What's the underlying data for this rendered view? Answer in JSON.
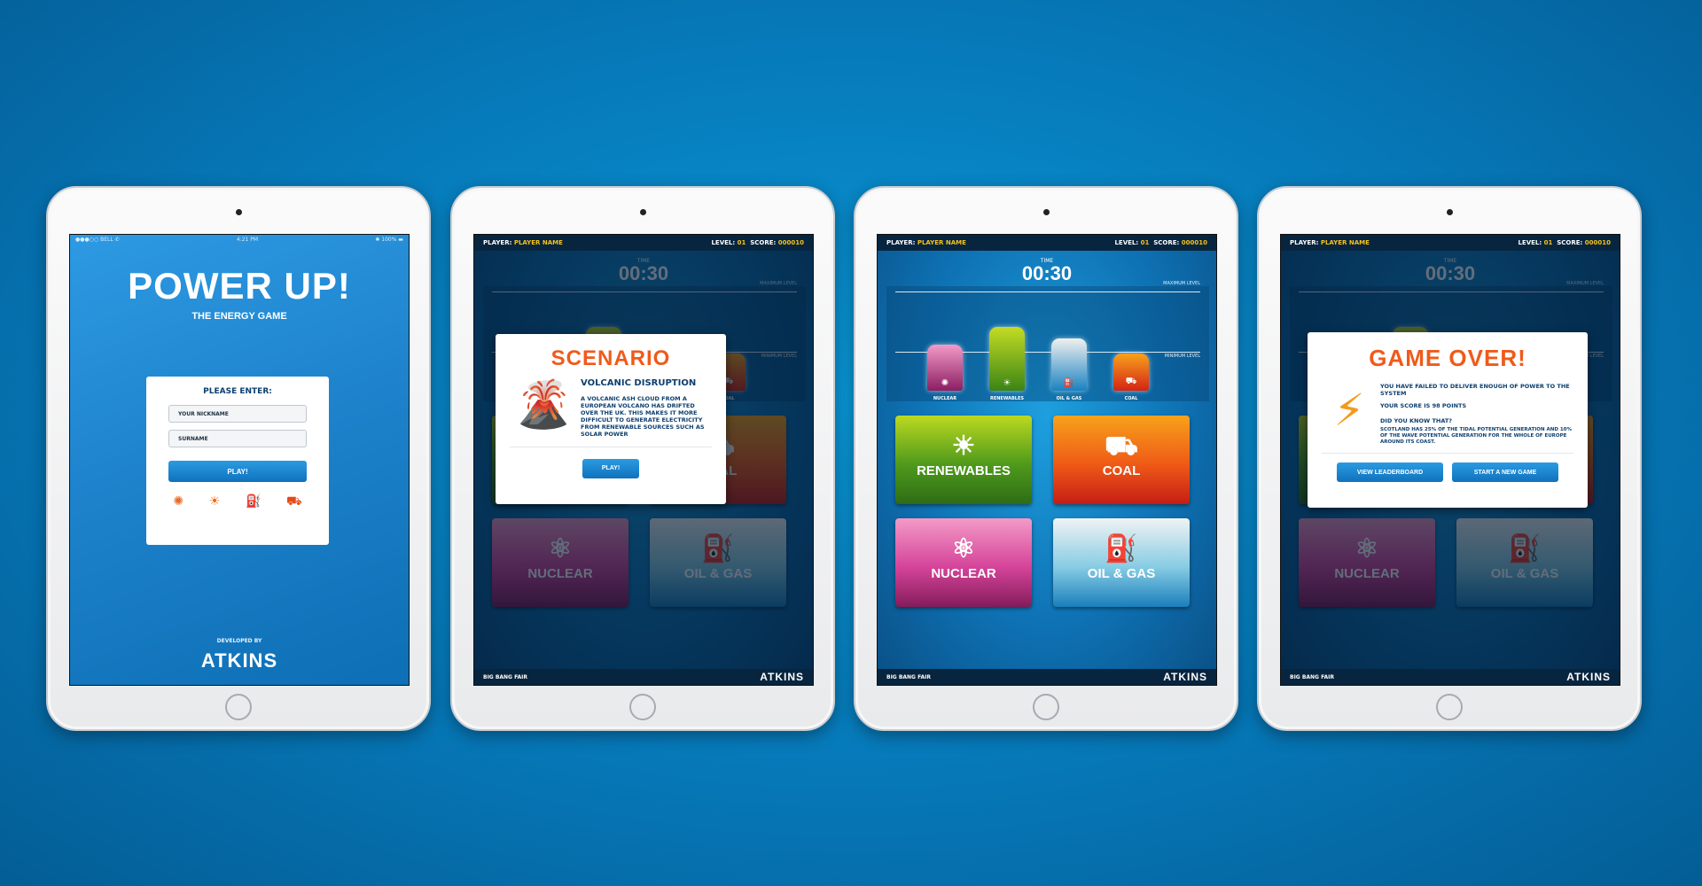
{
  "colors": {
    "background": "#0678b8",
    "accent_orange": "#f05a1a",
    "brand_blue": "#0f72bd",
    "hud_yellow": "#f6c21a"
  },
  "login": {
    "status": {
      "carrier": "●●●○○ BELL ✆",
      "time": "4:21 PM",
      "battery": "✱ 100% ▬"
    },
    "title": "POWER UP!",
    "subtitle": "THE ENERGY GAME",
    "prompt": "PLEASE ENTER:",
    "nickname_placeholder": "YOUR NICKNAME",
    "surname_placeholder": "SURNAME",
    "play_label": "PLAY!",
    "icons": [
      "nuclear-icon",
      "renewables-icon",
      "oil-gas-icon",
      "coal-icon"
    ],
    "developed_by": "DEVELOPED BY",
    "logo": "ATKINS"
  },
  "hud": {
    "player_label": "PLAYER:",
    "player_name": "PLAYER NAME",
    "level_label": "LEVEL:",
    "level": "01",
    "score_label": "SCORE:",
    "score": "000010",
    "time_label": "TIME",
    "time": "00:30",
    "max_label": "MAXIMUM LEVEL",
    "min_label": "MINIMUM LEVEL"
  },
  "energy": {
    "bars": [
      {
        "label": "NUCLEAR",
        "level": 0.52,
        "color_top": "#f29ac8",
        "color_bottom": "#8b1e62"
      },
      {
        "label": "RENEWABLES",
        "level": 0.72,
        "color_top": "#c4dc23",
        "color_bottom": "#3b8416"
      },
      {
        "label": "OIL & GAS",
        "level": 0.59,
        "color_top": "#f0f0ee",
        "color_bottom": "#1a82c2"
      },
      {
        "label": "COAL",
        "level": 0.42,
        "color_top": "#f8a11c",
        "color_bottom": "#d42414"
      }
    ],
    "tiles": {
      "renewables": "RENEWABLES",
      "coal": "COAL",
      "nuclear": "NUCLEAR",
      "oil_gas": "OIL & GAS"
    }
  },
  "footer": {
    "event": "BIG BANG FAIR",
    "logo": "ATKINS"
  },
  "scenario": {
    "title": "SCENARIO",
    "heading": "VOLCANIC DISRUPTION",
    "body": "A VOLCANIC ASH CLOUD FROM A EUROPEAN VOLCANO HAS DRIFTED OVER THE UK. THIS MAKES IT MORE DIFFICULT TO GENERATE ELECTRICITY FROM RENEWABLE SOURCES SUCH AS SOLAR POWER",
    "play_label": "PLAY!"
  },
  "gameover": {
    "title": "GAME OVER!",
    "message": "YOU HAVE FAILED TO DELIVER ENOUGH OF POWER TO THE SYSTEM",
    "score_text": "YOUR SCORE IS 98 POINTS",
    "fact_heading": "DID YOU KNOW THAT?",
    "fact_body": "SCOTLAND HAS 25% OF THE TIDAL POTENTIAL GENERATION AND 10% OF THE WAVE POTENTIAL GENERATION FOR THE WHOLE OF EUROPE AROUND ITS COAST.",
    "leaderboard_label": "VIEW LEADERBOARD",
    "new_game_label": "START A NEW GAME"
  }
}
